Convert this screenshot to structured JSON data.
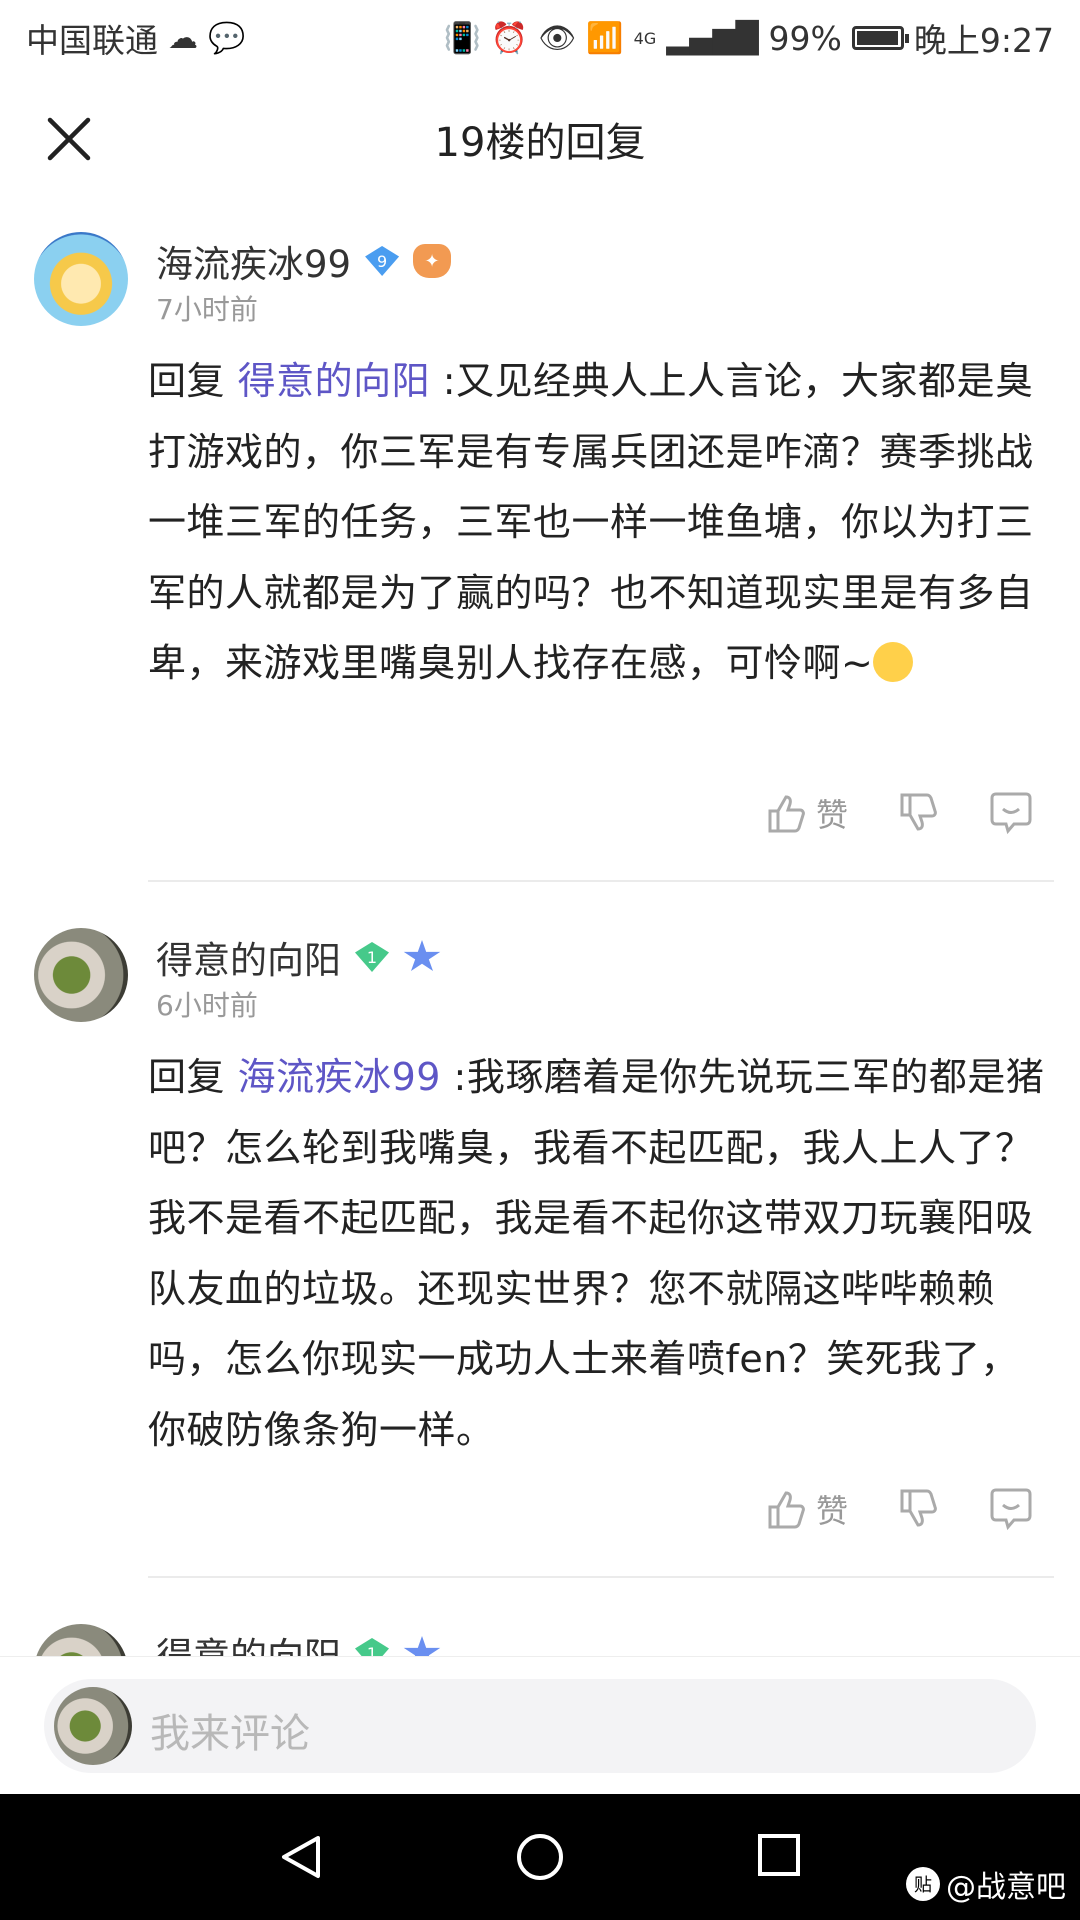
{
  "status_bar": {
    "carrier": "中国联通",
    "network": "4G",
    "battery": "99%",
    "time": "晚上9:27"
  },
  "header": {
    "title": "19楼的回复",
    "close_icon": "close-icon"
  },
  "comments": [
    {
      "username": "海流疾冰99",
      "level": "9",
      "time": "7小时前",
      "reply_prefix": "回复 ",
      "mention": "得意的向阳",
      "text": " :又见经典人上人言论，大家都是臭打游戏的，你三军是有专属兵团还是咋滴？赛季挑战一堆三军的任务，三军也一样一堆鱼塘，你以为打三军的人就都是为了赢的吗？也不知道现实里是有多自卑，来游戏里嘴臭别人找存在感，可怜啊~",
      "like_label": "赞"
    },
    {
      "username": "得意的向阳",
      "level": "1",
      "time": "6小时前",
      "reply_prefix": "回复 ",
      "mention": "海流疾冰99",
      "text": " :我琢磨着是你先说玩三军的都是猪吧？怎么轮到我嘴臭，我看不起匹配，我人上人了？我不是看不起匹配，我是看不起你这带双刀玩襄阳吸队友血的垃圾。还现实世界？您不就隔这哔哔赖赖吗，怎么你现实一成功人士来着喷fen？笑死我了，你破防像条狗一样。",
      "like_label": "赞"
    },
    {
      "username": "得意的向阳",
      "level": "1"
    }
  ],
  "comment_bar": {
    "placeholder": "我来评论"
  },
  "watermark": {
    "icon_text": "贴",
    "text": "@战意吧"
  }
}
